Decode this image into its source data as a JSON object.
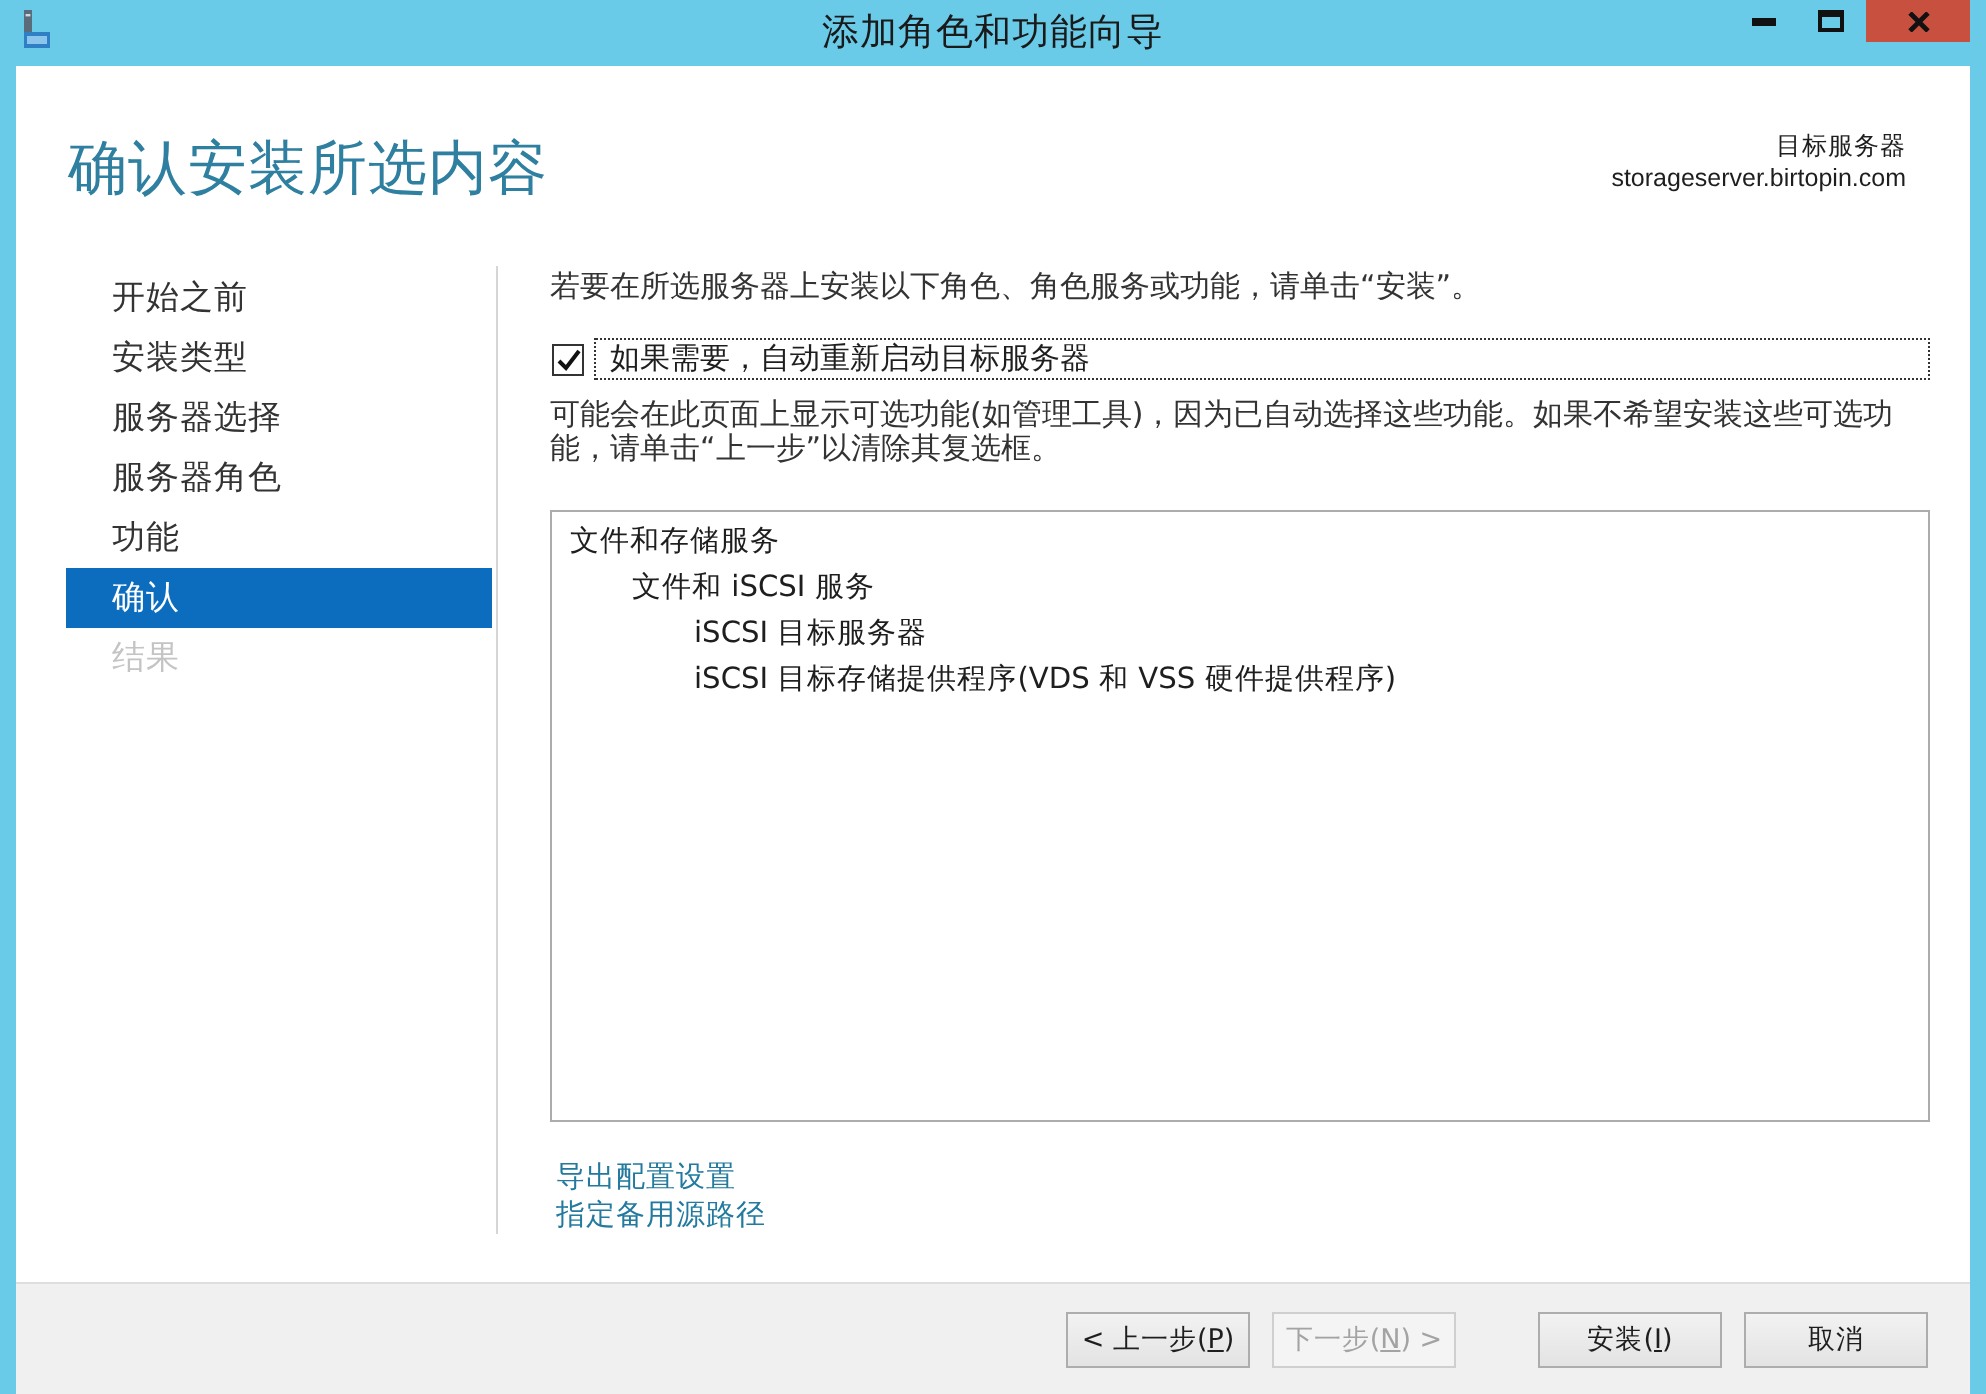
{
  "window": {
    "title": "添加角色和功能向导",
    "controls": [
      {
        "kind": "minimize"
      },
      {
        "kind": "maximize"
      },
      {
        "kind": "close"
      }
    ]
  },
  "header": {
    "title": "确认安装所选内容",
    "target_label": "目标服务器",
    "target_server": "storageserver.birtopin.com"
  },
  "steps": [
    {
      "label": "开始之前",
      "selected": false,
      "disabled": false
    },
    {
      "label": "安装类型",
      "selected": false,
      "disabled": false
    },
    {
      "label": "服务器选择",
      "selected": false,
      "disabled": false
    },
    {
      "label": "服务器角色",
      "selected": false,
      "disabled": false
    },
    {
      "label": "功能",
      "selected": false,
      "disabled": false
    },
    {
      "label": "确认",
      "selected": true,
      "disabled": false
    },
    {
      "label": "结果",
      "selected": false,
      "disabled": true
    }
  ],
  "content": {
    "intro": "若要在所选服务器上安装以下角色、角色服务或功能，请单击“安装”。",
    "restart_checkbox": {
      "label": "如果需要，自动重新启动目标服务器",
      "checked": true,
      "focused": true
    },
    "note": "可能会在此页面上显示可选功能(如管理工具)，因为已自动选择这些功能。如果不希望安装这些可选功能，请单击“上一步”以清除其复选框。",
    "selection": [
      {
        "label": "文件和存储服务",
        "children": [
          {
            "label": "文件和 iSCSI 服务",
            "children": [
              {
                "label": "iSCSI 目标服务器"
              },
              {
                "label": "iSCSI 目标存储提供程序(VDS 和 VSS 硬件提供程序)"
              }
            ]
          }
        ]
      }
    ],
    "links": [
      "导出配置设置",
      "指定备用源路径"
    ]
  },
  "footer": {
    "navigation": [
      {
        "label_before": "< 上一步(",
        "access_key": "P",
        "label_after": ")",
        "disabled": false
      },
      {
        "label_before": "下一步(",
        "access_key": "N",
        "label_after": ") >",
        "disabled": true
      }
    ],
    "actions": [
      {
        "label_before": "安装(",
        "access_key": "I",
        "label_after": ")",
        "disabled": false
      },
      {
        "label_before": "取消",
        "disabled": false
      }
    ]
  }
}
